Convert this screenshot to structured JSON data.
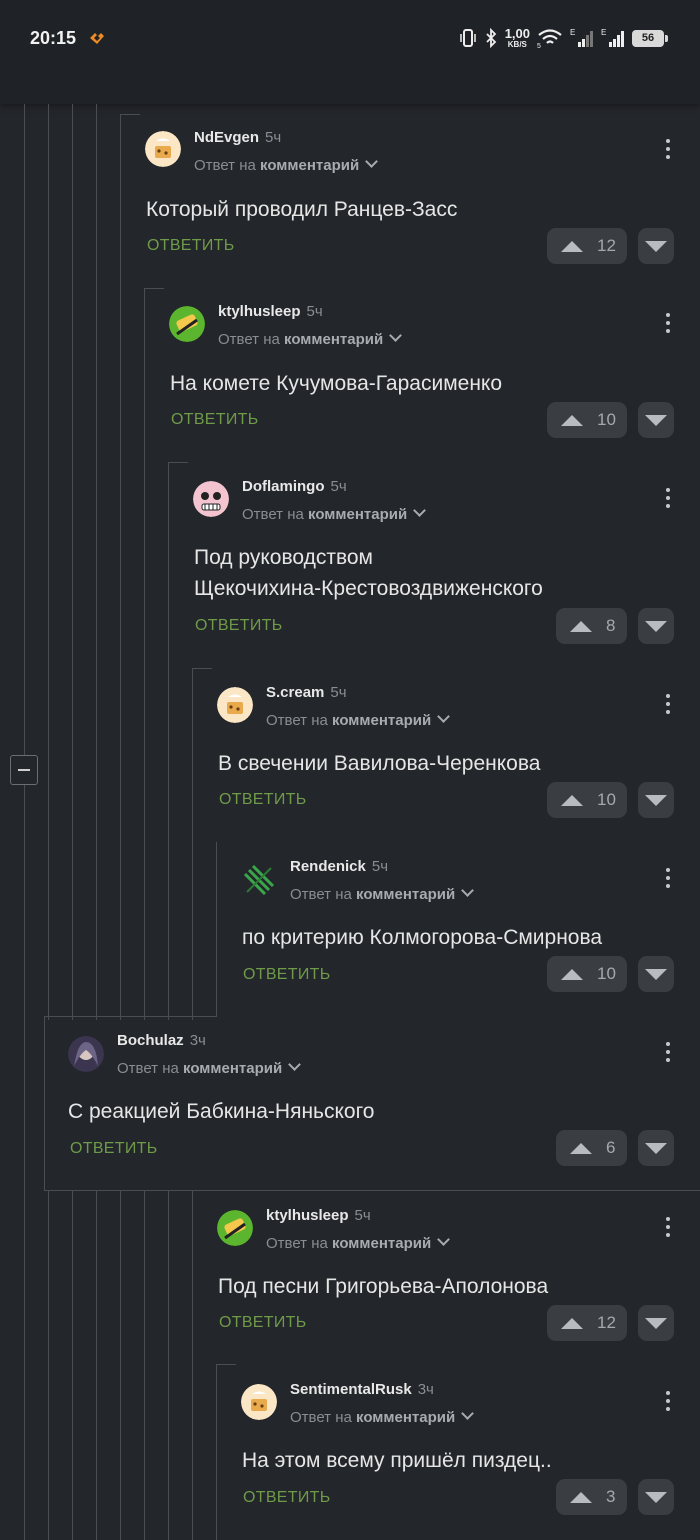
{
  "status_bar": {
    "time": "20:15",
    "net_speed_value": "1,00",
    "net_speed_unit": "KB/S",
    "battery": "56"
  },
  "comments": [
    {
      "author": "NdEvgen",
      "time": "5ч",
      "reply_prefix": "Ответ на",
      "reply_target": "комментарий",
      "text": "Который проводил Ранцев-Засс",
      "reply_label": "ОТВЕТИТЬ",
      "votes": "12",
      "avatar": "cookie-avatar"
    },
    {
      "author": "ktylhusleep",
      "time": "5ч",
      "reply_prefix": "Ответ на",
      "reply_target": "комментарий",
      "text": "На комете Кучумова-Гарасименко",
      "reply_label": "ОТВЕТИТЬ",
      "votes": "10",
      "avatar": "green-avatar"
    },
    {
      "author": "Doflamingo",
      "time": "5ч",
      "reply_prefix": "Ответ на",
      "reply_target": "комментарий",
      "text_line1": "Под руководством",
      "text_line2": "Щекочихина-Крестовоздвиженского",
      "reply_label": "ОТВЕТИТЬ",
      "votes": "8",
      "avatar": "skull-avatar"
    },
    {
      "author": "S.cream",
      "time": "5ч",
      "reply_prefix": "Ответ на",
      "reply_target": "комментарий",
      "text": "В свечении Вавилова-Черенкова",
      "reply_label": "ОТВЕТИТЬ",
      "votes": "10",
      "avatar": "cookie-avatar"
    },
    {
      "author": "Rendenick",
      "time": "5ч",
      "reply_prefix": "Ответ на",
      "reply_target": "комментарий",
      "text": "по критерию Колмогорова-Смирнова",
      "reply_label": "ОТВЕТИТЬ",
      "votes": "10",
      "avatar": "stripes-avatar"
    },
    {
      "author": "Bochulaz",
      "time": "3ч",
      "reply_prefix": "Ответ на",
      "reply_target": "комментарий",
      "text": "С реакцией Бабкина-Няньского",
      "reply_label": "ОТВЕТИТЬ",
      "votes": "6",
      "avatar": "girl-avatar"
    },
    {
      "author": "ktylhusleep",
      "time": "5ч",
      "reply_prefix": "Ответ на",
      "reply_target": "комментарий",
      "text": "Под песни Григорьева-Аполонова",
      "reply_label": "ОТВЕТИТЬ",
      "votes": "12",
      "avatar": "green-avatar"
    },
    {
      "author": "SentimentalRusk",
      "time": "3ч",
      "reply_prefix": "Ответ на",
      "reply_target": "комментарий",
      "text": "На этом всему пришёл пиздец..",
      "reply_label": "ОТВЕТИТЬ",
      "votes": "3",
      "avatar": "cookie-avatar"
    }
  ]
}
